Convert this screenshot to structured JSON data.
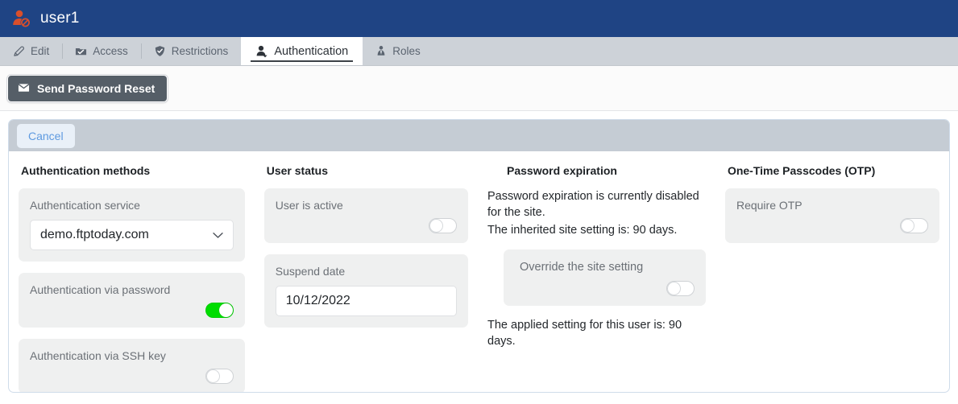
{
  "header": {
    "title": "user1",
    "icon": "blocked-user-icon",
    "bg_color": "#1f4484"
  },
  "tabs": [
    {
      "label": "Edit",
      "icon": "pencil-icon",
      "active": false
    },
    {
      "label": "Access",
      "icon": "folder-check-icon",
      "active": false
    },
    {
      "label": "Restrictions",
      "icon": "shield-icon",
      "active": false
    },
    {
      "label": "Authentication",
      "icon": "user-auth-icon",
      "active": true
    },
    {
      "label": "Roles",
      "icon": "roles-icon",
      "active": false
    }
  ],
  "toolbar": {
    "send_password_reset_label": "Send Password Reset",
    "send_password_reset_icon": "envelope-icon"
  },
  "panel": {
    "cancel_label": "Cancel"
  },
  "auth_methods": {
    "title": "Authentication methods",
    "service_label": "Authentication service",
    "service_value": "demo.ftptoday.com",
    "service_chevron": "chevron-down-icon",
    "password_label": "Authentication via password",
    "password_state": "on",
    "sshkey_label": "Authentication via SSH key",
    "sshkey_state": "off"
  },
  "user_status": {
    "title": "User status",
    "active_label": "User is active",
    "active_state": "off",
    "suspend_label": "Suspend date",
    "suspend_value": "10/12/2022"
  },
  "password_expiration": {
    "title": "Password expiration",
    "line1": "Password expiration is currently disabled for the site.",
    "line2": "The inherited site setting is: 90 days.",
    "override_label": "Override the site setting",
    "override_state": "off",
    "applied_line": "The applied setting for this user is: 90 days."
  },
  "otp": {
    "title": "One-Time Passcodes (OTP)",
    "require_label": "Require OTP",
    "require_state": "off"
  },
  "colors": {
    "header_blue": "#1f4484",
    "tab_gray": "#cdd2d8",
    "toggle_on_green": "#00dd00",
    "cancel_blue": "#5e9ae0",
    "button_dark": "#555e67"
  }
}
